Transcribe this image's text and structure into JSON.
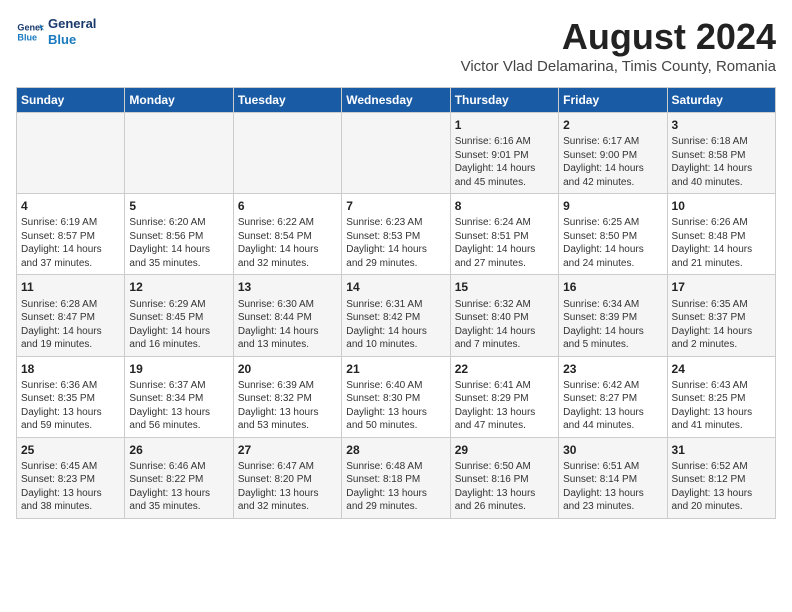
{
  "header": {
    "logo_line1": "General",
    "logo_line2": "Blue",
    "title": "August 2024",
    "subtitle": "Victor Vlad Delamarina, Timis County, Romania"
  },
  "weekdays": [
    "Sunday",
    "Monday",
    "Tuesday",
    "Wednesday",
    "Thursday",
    "Friday",
    "Saturday"
  ],
  "weeks": [
    [
      {
        "day": "",
        "info": ""
      },
      {
        "day": "",
        "info": ""
      },
      {
        "day": "",
        "info": ""
      },
      {
        "day": "",
        "info": ""
      },
      {
        "day": "1",
        "info": "Sunrise: 6:16 AM\nSunset: 9:01 PM\nDaylight: 14 hours\nand 45 minutes."
      },
      {
        "day": "2",
        "info": "Sunrise: 6:17 AM\nSunset: 9:00 PM\nDaylight: 14 hours\nand 42 minutes."
      },
      {
        "day": "3",
        "info": "Sunrise: 6:18 AM\nSunset: 8:58 PM\nDaylight: 14 hours\nand 40 minutes."
      }
    ],
    [
      {
        "day": "4",
        "info": "Sunrise: 6:19 AM\nSunset: 8:57 PM\nDaylight: 14 hours\nand 37 minutes."
      },
      {
        "day": "5",
        "info": "Sunrise: 6:20 AM\nSunset: 8:56 PM\nDaylight: 14 hours\nand 35 minutes."
      },
      {
        "day": "6",
        "info": "Sunrise: 6:22 AM\nSunset: 8:54 PM\nDaylight: 14 hours\nand 32 minutes."
      },
      {
        "day": "7",
        "info": "Sunrise: 6:23 AM\nSunset: 8:53 PM\nDaylight: 14 hours\nand 29 minutes."
      },
      {
        "day": "8",
        "info": "Sunrise: 6:24 AM\nSunset: 8:51 PM\nDaylight: 14 hours\nand 27 minutes."
      },
      {
        "day": "9",
        "info": "Sunrise: 6:25 AM\nSunset: 8:50 PM\nDaylight: 14 hours\nand 24 minutes."
      },
      {
        "day": "10",
        "info": "Sunrise: 6:26 AM\nSunset: 8:48 PM\nDaylight: 14 hours\nand 21 minutes."
      }
    ],
    [
      {
        "day": "11",
        "info": "Sunrise: 6:28 AM\nSunset: 8:47 PM\nDaylight: 14 hours\nand 19 minutes."
      },
      {
        "day": "12",
        "info": "Sunrise: 6:29 AM\nSunset: 8:45 PM\nDaylight: 14 hours\nand 16 minutes."
      },
      {
        "day": "13",
        "info": "Sunrise: 6:30 AM\nSunset: 8:44 PM\nDaylight: 14 hours\nand 13 minutes."
      },
      {
        "day": "14",
        "info": "Sunrise: 6:31 AM\nSunset: 8:42 PM\nDaylight: 14 hours\nand 10 minutes."
      },
      {
        "day": "15",
        "info": "Sunrise: 6:32 AM\nSunset: 8:40 PM\nDaylight: 14 hours\nand 7 minutes."
      },
      {
        "day": "16",
        "info": "Sunrise: 6:34 AM\nSunset: 8:39 PM\nDaylight: 14 hours\nand 5 minutes."
      },
      {
        "day": "17",
        "info": "Sunrise: 6:35 AM\nSunset: 8:37 PM\nDaylight: 14 hours\nand 2 minutes."
      }
    ],
    [
      {
        "day": "18",
        "info": "Sunrise: 6:36 AM\nSunset: 8:35 PM\nDaylight: 13 hours\nand 59 minutes."
      },
      {
        "day": "19",
        "info": "Sunrise: 6:37 AM\nSunset: 8:34 PM\nDaylight: 13 hours\nand 56 minutes."
      },
      {
        "day": "20",
        "info": "Sunrise: 6:39 AM\nSunset: 8:32 PM\nDaylight: 13 hours\nand 53 minutes."
      },
      {
        "day": "21",
        "info": "Sunrise: 6:40 AM\nSunset: 8:30 PM\nDaylight: 13 hours\nand 50 minutes."
      },
      {
        "day": "22",
        "info": "Sunrise: 6:41 AM\nSunset: 8:29 PM\nDaylight: 13 hours\nand 47 minutes."
      },
      {
        "day": "23",
        "info": "Sunrise: 6:42 AM\nSunset: 8:27 PM\nDaylight: 13 hours\nand 44 minutes."
      },
      {
        "day": "24",
        "info": "Sunrise: 6:43 AM\nSunset: 8:25 PM\nDaylight: 13 hours\nand 41 minutes."
      }
    ],
    [
      {
        "day": "25",
        "info": "Sunrise: 6:45 AM\nSunset: 8:23 PM\nDaylight: 13 hours\nand 38 minutes."
      },
      {
        "day": "26",
        "info": "Sunrise: 6:46 AM\nSunset: 8:22 PM\nDaylight: 13 hours\nand 35 minutes."
      },
      {
        "day": "27",
        "info": "Sunrise: 6:47 AM\nSunset: 8:20 PM\nDaylight: 13 hours\nand 32 minutes."
      },
      {
        "day": "28",
        "info": "Sunrise: 6:48 AM\nSunset: 8:18 PM\nDaylight: 13 hours\nand 29 minutes."
      },
      {
        "day": "29",
        "info": "Sunrise: 6:50 AM\nSunset: 8:16 PM\nDaylight: 13 hours\nand 26 minutes."
      },
      {
        "day": "30",
        "info": "Sunrise: 6:51 AM\nSunset: 8:14 PM\nDaylight: 13 hours\nand 23 minutes."
      },
      {
        "day": "31",
        "info": "Sunrise: 6:52 AM\nSunset: 8:12 PM\nDaylight: 13 hours\nand 20 minutes."
      }
    ]
  ]
}
